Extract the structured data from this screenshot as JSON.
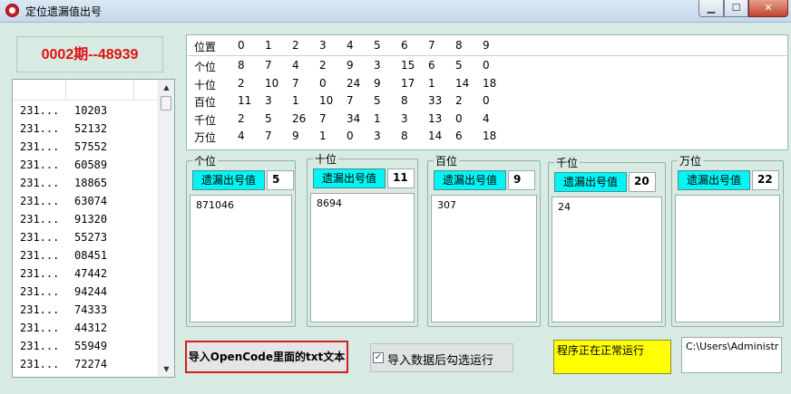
{
  "window": {
    "title": "定位遗漏值出号"
  },
  "period": {
    "text": "0002期--48939"
  },
  "draw_list": {
    "rows": [
      {
        "c1": "231...",
        "c2": "10203"
      },
      {
        "c1": "231...",
        "c2": "52132"
      },
      {
        "c1": "231...",
        "c2": "57552"
      },
      {
        "c1": "231...",
        "c2": "60589"
      },
      {
        "c1": "231...",
        "c2": "18865"
      },
      {
        "c1": "231...",
        "c2": "63074"
      },
      {
        "c1": "231...",
        "c2": "91320"
      },
      {
        "c1": "231...",
        "c2": "55273"
      },
      {
        "c1": "231...",
        "c2": "08451"
      },
      {
        "c1": "231...",
        "c2": "47442"
      },
      {
        "c1": "231...",
        "c2": "94244"
      },
      {
        "c1": "231...",
        "c2": "74333"
      },
      {
        "c1": "231...",
        "c2": "44312"
      },
      {
        "c1": "231...",
        "c2": "55949"
      },
      {
        "c1": "231...",
        "c2": "72274"
      }
    ]
  },
  "stats_table": {
    "headers": [
      "位置",
      "0",
      "1",
      "2",
      "3",
      "4",
      "5",
      "6",
      "7",
      "8",
      "9"
    ],
    "rows": [
      [
        "个位",
        "8",
        "7",
        "4",
        "2",
        "9",
        "3",
        "15",
        "6",
        "5",
        "0"
      ],
      [
        "十位",
        "2",
        "10",
        "7",
        "0",
        "24",
        "9",
        "17",
        "1",
        "14",
        "18"
      ],
      [
        "百位",
        "11",
        "3",
        "1",
        "10",
        "7",
        "5",
        "8",
        "33",
        "2",
        "0"
      ],
      [
        "千位",
        "2",
        "5",
        "26",
        "7",
        "34",
        "1",
        "3",
        "13",
        "0",
        "4"
      ],
      [
        "万位",
        "4",
        "7",
        "9",
        "1",
        "0",
        "3",
        "8",
        "14",
        "6",
        "18"
      ]
    ]
  },
  "groups": [
    {
      "title": "个位",
      "label": "遗漏出号值",
      "value": "5",
      "output": "871046"
    },
    {
      "title": "十位",
      "label": "遗漏出号值",
      "value": "11",
      "output": "8694"
    },
    {
      "title": "百位",
      "label": "遗漏出号值",
      "value": "9",
      "output": "307"
    },
    {
      "title": "千位",
      "label": "遗漏出号值",
      "value": "20",
      "output": "24"
    },
    {
      "title": "万位",
      "label": "遗漏出号值",
      "value": "22",
      "output": ""
    }
  ],
  "controls": {
    "import_button": "导入OpenCode里面的txt文本",
    "auto_run_label": "导入数据后勾选运行",
    "auto_run_checked": true,
    "status_text": "程序正在正常运行",
    "path_text": "C:\\Users\\Administr"
  }
}
